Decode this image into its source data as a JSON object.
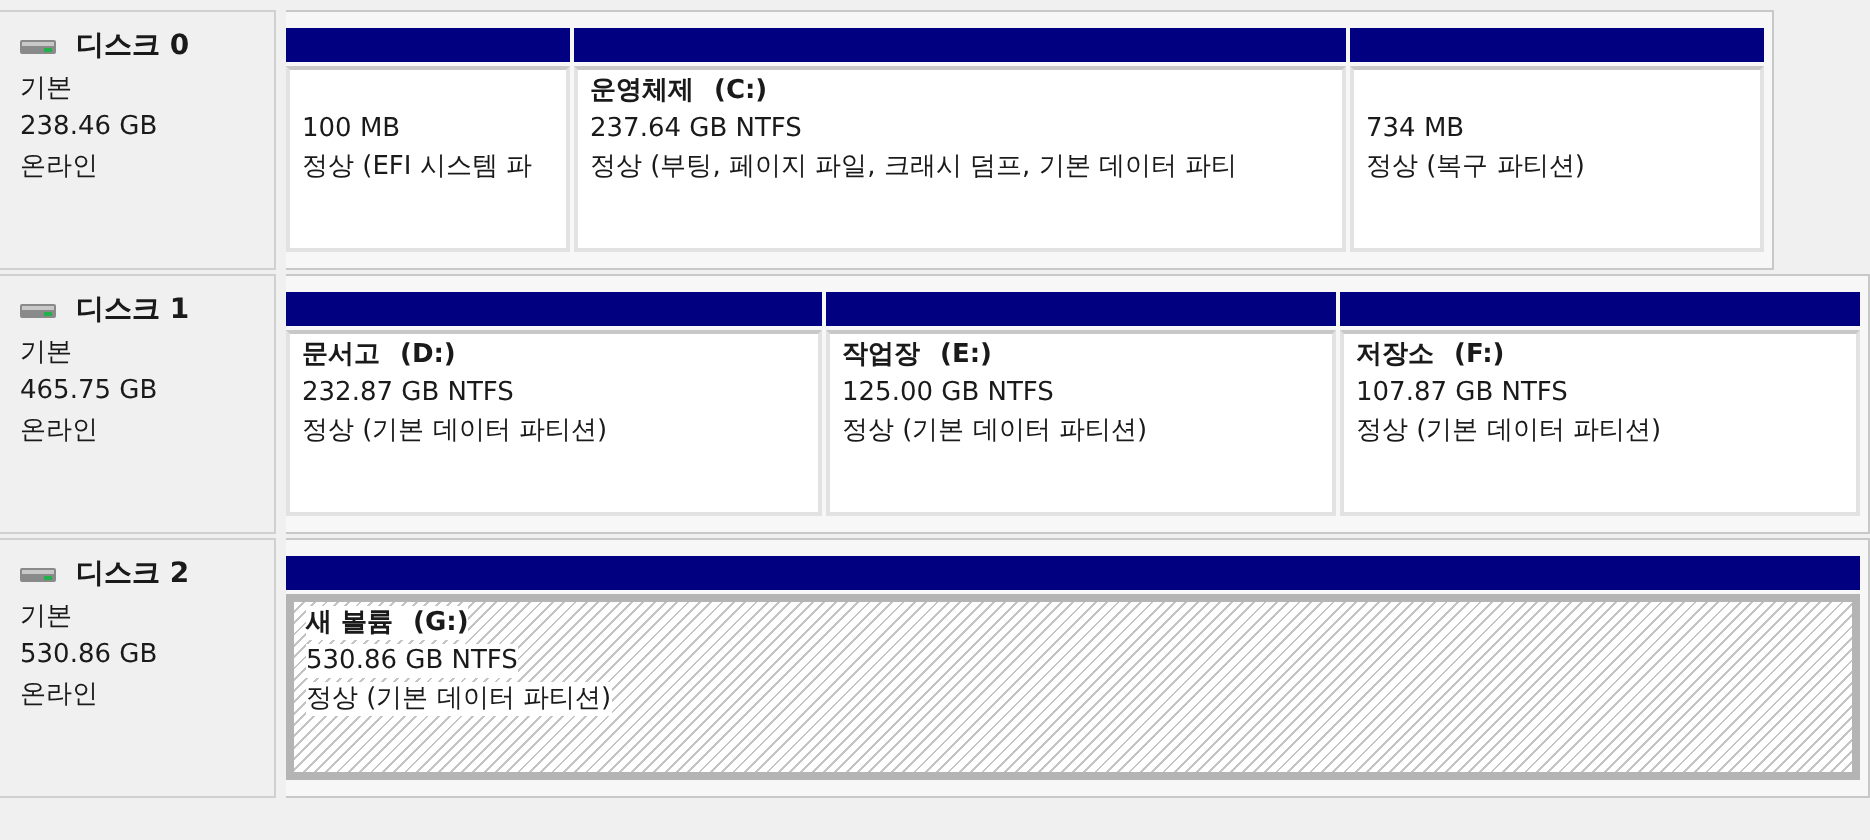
{
  "disks": [
    {
      "name": "디스크 0",
      "type": "기본",
      "size": "238.46 GB",
      "status": "온라인",
      "partitions": [
        {
          "size": "100 MB",
          "state": "정상 (EFI 시스템 파",
          "selected": false
        },
        {
          "label": "운영체제",
          "drive": "(C:)",
          "size": "237.64 GB NTFS",
          "state": "정상 (부팅, 페이지 파일, 크래시 덤프, 기본 데이터 파티",
          "selected": false
        },
        {
          "size": "734 MB",
          "state": "정상 (복구 파티션)",
          "selected": false
        }
      ]
    },
    {
      "name": "디스크 1",
      "type": "기본",
      "size": "465.75 GB",
      "status": "온라인",
      "partitions": [
        {
          "label": "문서고",
          "drive": "(D:)",
          "size": "232.87 GB NTFS",
          "state": "정상 (기본 데이터 파티션)",
          "selected": false
        },
        {
          "label": "작업장",
          "drive": "(E:)",
          "size": "125.00 GB NTFS",
          "state": "정상 (기본 데이터 파티션)",
          "selected": false
        },
        {
          "label": "저장소",
          "drive": "(F:)",
          "size": "107.87 GB NTFS",
          "state": "정상 (기본 데이터 파티션)",
          "selected": false
        }
      ]
    },
    {
      "name": "디스크 2",
      "type": "기본",
      "size": "530.86 GB",
      "status": "온라인",
      "partitions": [
        {
          "label": "새 볼륨",
          "drive": "(G:)",
          "size": "530.86 GB NTFS",
          "state": "정상 (기본 데이터 파티션)",
          "selected": true
        }
      ]
    }
  ]
}
